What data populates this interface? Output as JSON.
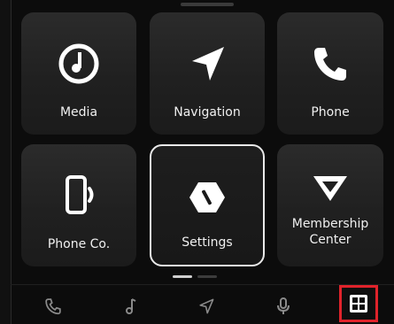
{
  "tiles": [
    {
      "label": "Media",
      "icon": "media-icon"
    },
    {
      "label": "Navigation",
      "icon": "navigation-icon"
    },
    {
      "label": "Phone",
      "icon": "phone-icon"
    },
    {
      "label": "Phone Co.",
      "icon": "phone-connect-icon"
    },
    {
      "label": "Settings",
      "icon": "settings-icon",
      "selected": true
    },
    {
      "label": "Membership\nCenter",
      "icon": "membership-icon"
    }
  ],
  "dock": {
    "items": [
      "phone-icon",
      "music-icon",
      "navigation-icon",
      "microphone-icon"
    ],
    "apps_button": "apps-grid-icon"
  },
  "colors": {
    "background": "#0c0c0c",
    "tile": "#262626",
    "highlight": "#e0232b",
    "icon": "#ffffff",
    "dock_icon": "#8a8a8a"
  }
}
